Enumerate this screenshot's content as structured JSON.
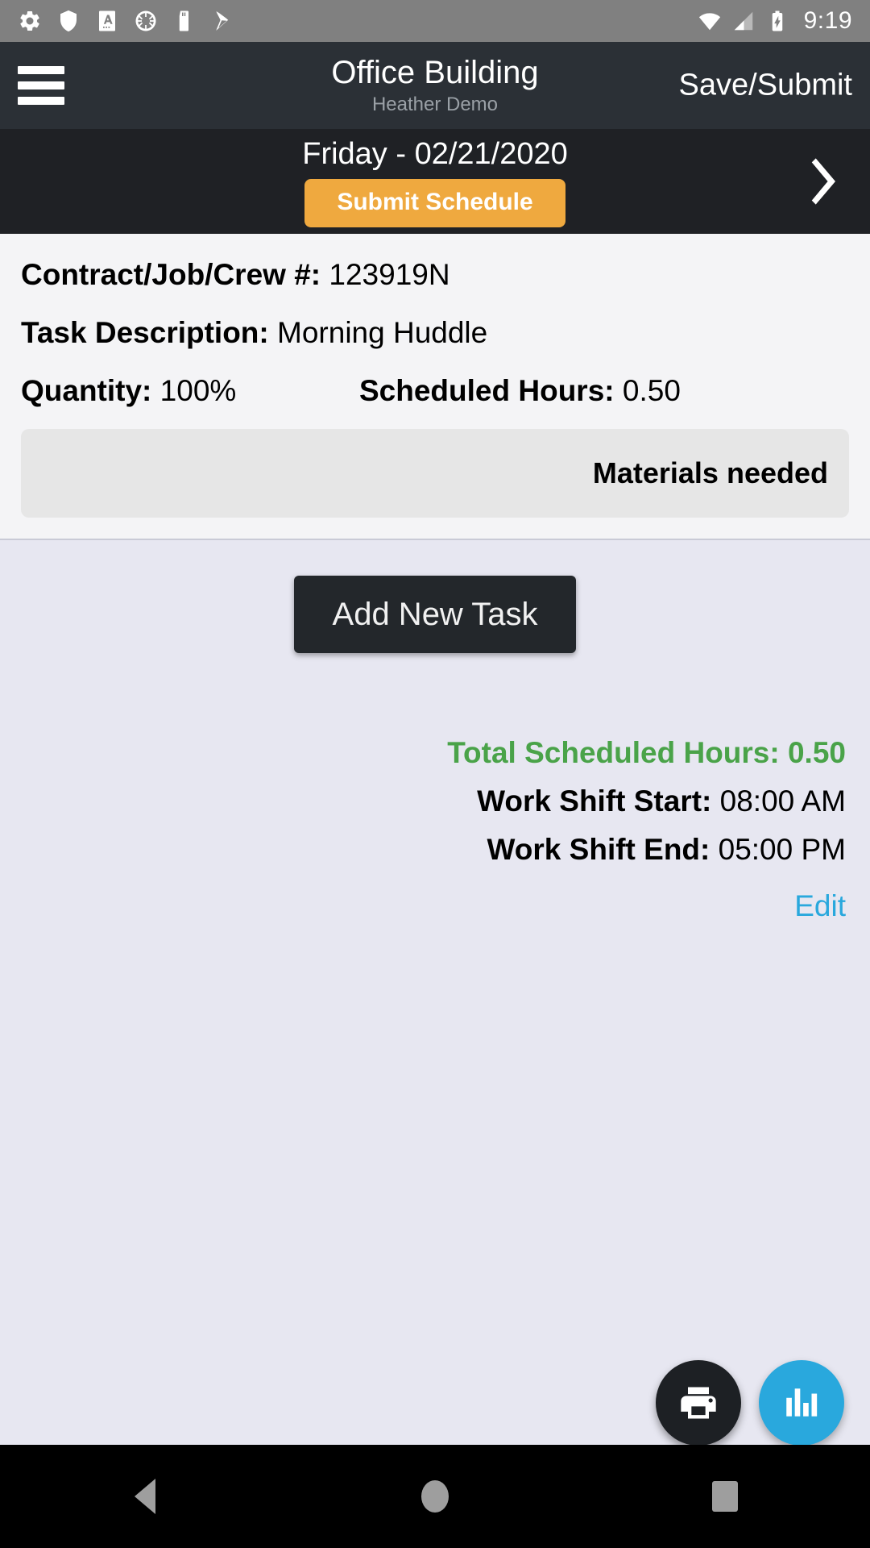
{
  "status_bar": {
    "icons": [
      "settings-gear-icon",
      "shield-icon",
      "a-box-icon",
      "loading-spinner-icon",
      "sd-card-icon",
      "play-store-icon"
    ],
    "right_icons": [
      "wifi-icon",
      "cellular-signal-icon",
      "battery-charging-icon"
    ],
    "clock": "9:19"
  },
  "app_bar": {
    "menu_icon": "hamburger-menu-icon",
    "title": "Office Building",
    "subtitle": "Heather Demo",
    "action_label": "Save/Submit"
  },
  "date_bar": {
    "date_label": "Friday - 02/21/2020",
    "submit_label": "Submit Schedule",
    "next_icon": "chevron-right-icon"
  },
  "task": {
    "contract_label": "Contract/Job/Crew #:",
    "contract_value": "123919N",
    "description_label": "Task Description:",
    "description_value": "Morning Huddle",
    "quantity_label": "Quantity:",
    "quantity_value": "100%",
    "scheduled_hours_label": "Scheduled Hours:",
    "scheduled_hours_value": "0.50",
    "materials_label": "Materials needed"
  },
  "actions": {
    "add_task_label": "Add New Task"
  },
  "summary": {
    "total_hours_label": "Total Scheduled Hours:",
    "total_hours_value": "0.50",
    "shift_start_label": "Work Shift Start:",
    "shift_start_value": "08:00 AM",
    "shift_end_label": "Work Shift End:",
    "shift_end_value": "05:00 PM",
    "edit_label": "Edit"
  },
  "fabs": {
    "print_icon": "printer-icon",
    "chart_icon": "bar-chart-icon"
  },
  "nav_bar": {
    "back_icon": "nav-back-icon",
    "home_icon": "nav-home-icon",
    "recents_icon": "nav-recents-icon"
  },
  "colors": {
    "accent_orange": "#efa93f",
    "accent_cyan": "#29a8dd",
    "accent_green": "#4aa349",
    "appbar_dark": "#2b3036",
    "datebar_dark": "#1f2125"
  }
}
